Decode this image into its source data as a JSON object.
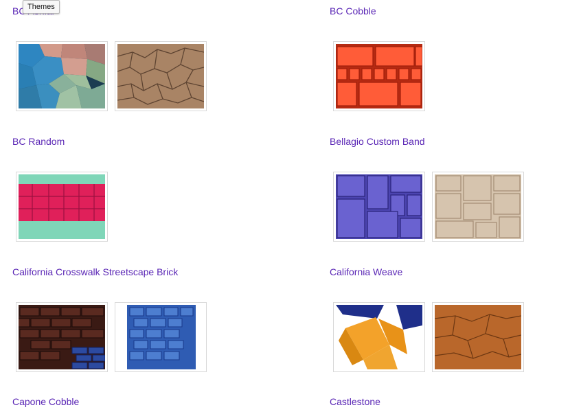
{
  "tooltip": {
    "text": "Themes"
  },
  "left_column": [
    {
      "title": "BC Ashlar",
      "thumbs": [
        "colored-flagstone",
        "tan-flagstone"
      ]
    },
    {
      "title": "BC Random",
      "thumbs": [
        "red-green-slate"
      ]
    },
    {
      "title": "California Crosswalk Streetscape Brick",
      "thumbs": [
        "dark-brick",
        "blue-cobble"
      ]
    }
  ],
  "right_column": [
    {
      "title": "BC Cobble",
      "thumbs": [
        "orange-cobble"
      ]
    },
    {
      "title": "Bellagio Custom Band",
      "thumbs": [
        "purple-ashlar",
        "beige-ashlar"
      ]
    },
    {
      "title": "California Weave",
      "thumbs": [
        "yellow-weave",
        "brown-stone"
      ]
    }
  ],
  "bottom_titles": {
    "left": "Capone Cobble",
    "right": "Castlestone"
  }
}
